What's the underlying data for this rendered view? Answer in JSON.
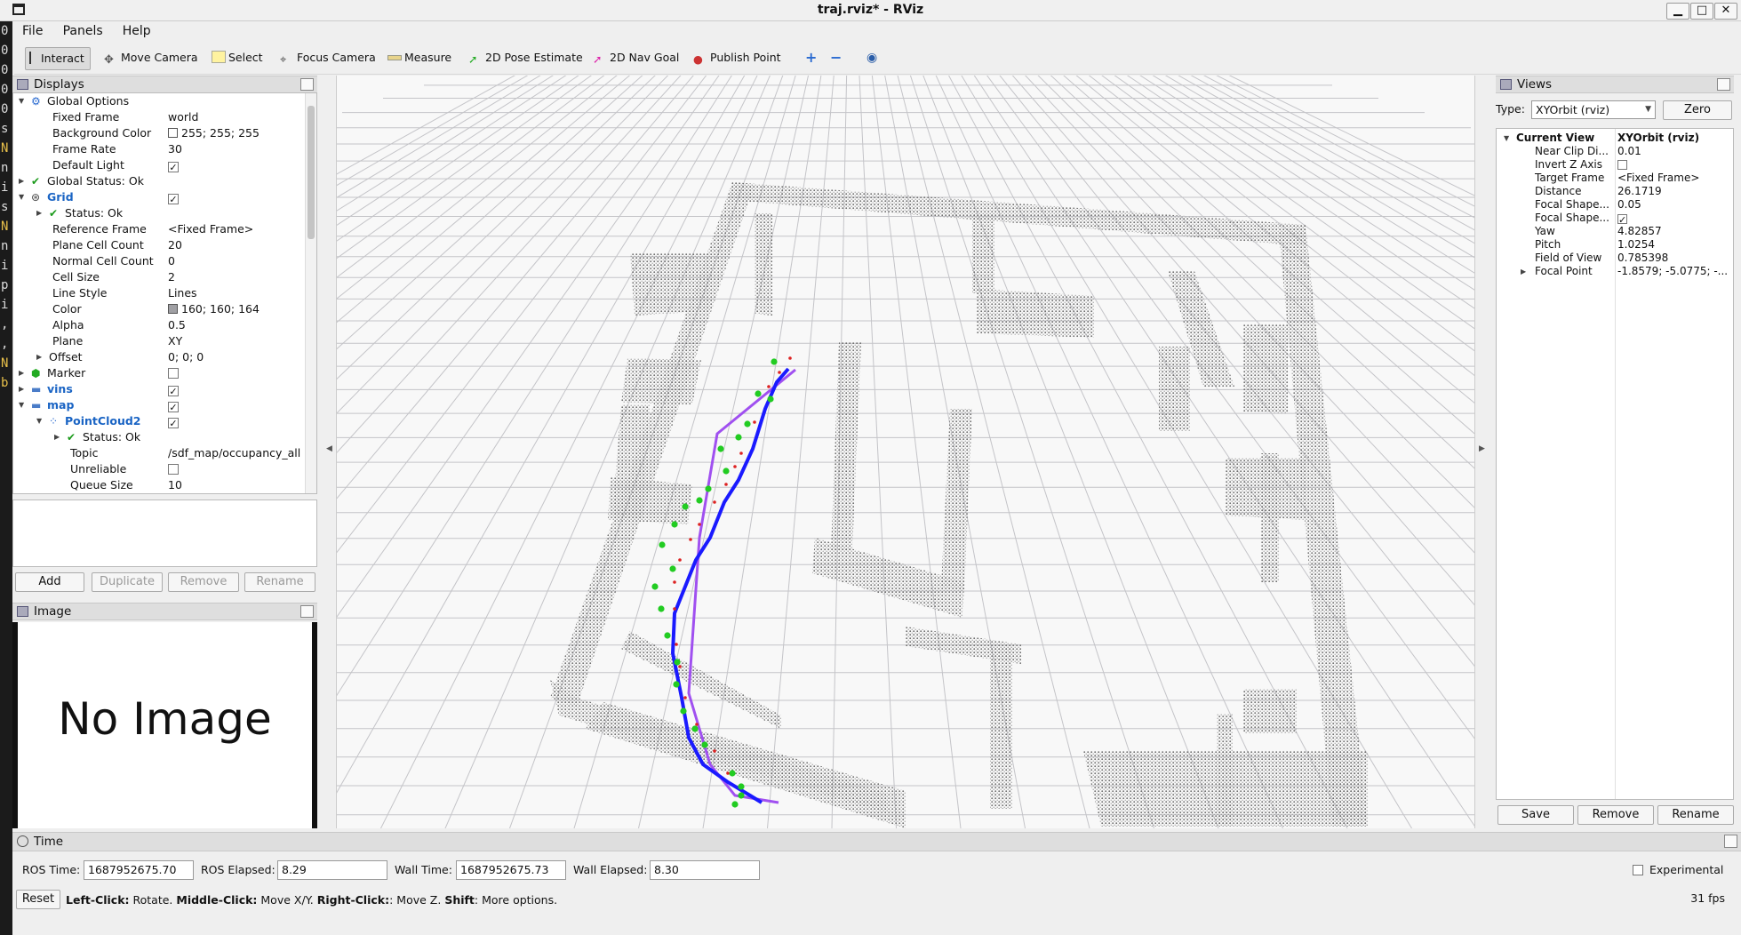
{
  "window": {
    "title": "traj.rviz* - RViz",
    "minimize": "▁",
    "maximize": "□",
    "close": "✕"
  },
  "terminal": {
    "chars": [
      "0",
      "0",
      "0",
      "0",
      "0",
      "s",
      "N",
      "n",
      "i",
      "s",
      "N",
      "n",
      "i",
      "p",
      "i",
      ",",
      ",",
      "N",
      "b"
    ]
  },
  "menu": [
    "File",
    "Panels",
    "Help"
  ],
  "toolbar": {
    "tools": [
      "Interact",
      "Move Camera",
      "Select",
      "Focus Camera",
      "Measure",
      "2D Pose Estimate",
      "2D Nav Goal",
      "Publish Point"
    ],
    "active": "Interact",
    "extra_icons": [
      "plus-icon",
      "minus-icon",
      "eye-icon"
    ]
  },
  "displays": {
    "title": "Displays",
    "rows": [
      {
        "key": "Global Options",
        "value": ""
      },
      {
        "key": "Fixed Frame",
        "value": "world"
      },
      {
        "key": "Background Color",
        "value": "255; 255; 255"
      },
      {
        "key": "Frame Rate",
        "value": "30"
      },
      {
        "key": "Default Light",
        "value": ""
      },
      {
        "key": "Global Status: Ok",
        "value": ""
      },
      {
        "key": "Grid",
        "value": ""
      },
      {
        "key": "Status: Ok",
        "value": ""
      },
      {
        "key": "Reference Frame",
        "value": "<Fixed Frame>"
      },
      {
        "key": "Plane Cell Count",
        "value": "20"
      },
      {
        "key": "Normal Cell Count",
        "value": "0"
      },
      {
        "key": "Cell Size",
        "value": "2"
      },
      {
        "key": "Line Style",
        "value": "Lines"
      },
      {
        "key": "Color",
        "value": "160; 160; 164"
      },
      {
        "key": "Alpha",
        "value": "0.5"
      },
      {
        "key": "Plane",
        "value": "XY"
      },
      {
        "key": "Offset",
        "value": "0; 0; 0"
      },
      {
        "key": "Marker",
        "value": ""
      },
      {
        "key": "vins",
        "value": ""
      },
      {
        "key": "map",
        "value": ""
      },
      {
        "key": "PointCloud2",
        "value": ""
      },
      {
        "key": "Status: Ok",
        "value": ""
      },
      {
        "key": "Topic",
        "value": "/sdf_map/occupancy_all"
      },
      {
        "key": "Unreliable",
        "value": ""
      },
      {
        "key": "Queue Size",
        "value": "10"
      }
    ],
    "buttons": [
      "Add",
      "Duplicate",
      "Remove",
      "Rename"
    ]
  },
  "image_panel": {
    "title": "Image",
    "placeholder": "No Image"
  },
  "views": {
    "title": "Views",
    "type_label": "Type:",
    "type_value": "XYOrbit (rviz)",
    "zero": "Zero",
    "rows": [
      {
        "key": "Current View",
        "value": "XYOrbit (rviz)"
      },
      {
        "key": "Near Clip Di...",
        "value": "0.01"
      },
      {
        "key": "Invert Z Axis",
        "value": ""
      },
      {
        "key": "Target Frame",
        "value": "<Fixed Frame>"
      },
      {
        "key": "Distance",
        "value": "26.1719"
      },
      {
        "key": "Focal Shape...",
        "value": "0.05"
      },
      {
        "key": "Focal Shape...",
        "value": ""
      },
      {
        "key": "Yaw",
        "value": "4.82857"
      },
      {
        "key": "Pitch",
        "value": "1.0254"
      },
      {
        "key": "Field of View",
        "value": "0.785398"
      },
      {
        "key": "Focal Point",
        "value": "-1.8579; -5.0775; -..."
      }
    ],
    "buttons": [
      "Save",
      "Remove",
      "Rename"
    ]
  },
  "time": {
    "title": "Time",
    "ros_time_label": "ROS Time:",
    "ros_time": "1687952675.70",
    "ros_elapsed_label": "ROS Elapsed:",
    "ros_elapsed": "8.29",
    "wall_time_label": "Wall Time:",
    "wall_time": "1687952675.73",
    "wall_elapsed_label": "Wall Elapsed:",
    "wall_elapsed": "8.30",
    "experimental": "Experimental"
  },
  "status": {
    "reset": "Reset",
    "hint_b1": "Left-Click:",
    "hint_1": " Rotate. ",
    "hint_b2": "Middle-Click:",
    "hint_2": " Move X/Y. ",
    "hint_b3": "Right-Click:",
    "hint_3": ": Move Z. ",
    "hint_b4": "Shift",
    "hint_4": ": More options.",
    "fps": "31 fps"
  },
  "colors": {
    "trajectory": "#1a1aff",
    "path": "#a050f0",
    "points": "#22cc22",
    "walls": "#666666"
  }
}
